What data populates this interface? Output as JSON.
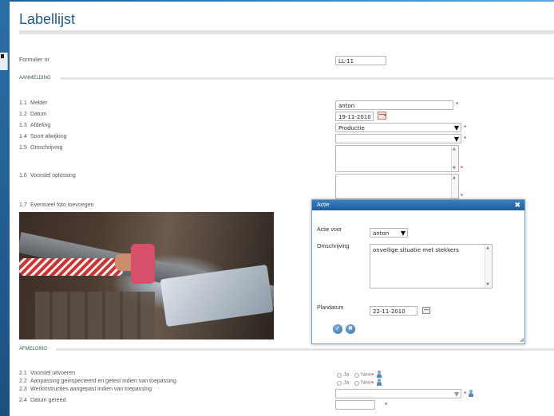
{
  "page_title": "Labellijst",
  "formulier": {
    "label": "Formulier nr.",
    "value": "LL-11"
  },
  "section_aanmelding": "AANMELDING",
  "fields": [
    {
      "num": "1.1",
      "label": "Melder",
      "value": "anton"
    },
    {
      "num": "1.2",
      "label": "Datum",
      "value": "19-11-2010"
    },
    {
      "num": "1.3",
      "label": "Afdeling",
      "value": "Productie"
    },
    {
      "num": "1.4",
      "label": "Soort afwijking",
      "value": ""
    },
    {
      "num": "1.5",
      "label": "Omschrijving",
      "value": ""
    },
    {
      "num": "1.6",
      "label": "Voorstel oplossing",
      "value": ""
    },
    {
      "num": "1.7",
      "label": "Eventueel foto toevoegen"
    }
  ],
  "required_mark": "*",
  "section_afmelding": "AFMELDING",
  "afmelding": [
    {
      "num": "2.1",
      "label": "Voorstel uitvoeren"
    },
    {
      "num": "2.2",
      "label": "Aanpassing geinspecteerd en getest indien van toepassing",
      "opt_yes": "Ja",
      "opt_no": "Nee"
    },
    {
      "num": "2.3",
      "label": "Werkinstructies aangepast indien van toepassing",
      "opt_yes": "Ja",
      "opt_no": "Nee"
    },
    {
      "num": "2.4",
      "label": "Datum gereed"
    }
  ],
  "dialog": {
    "title": "Actie",
    "actie_voor_label": "Actie voor",
    "actie_voor_value": "anton",
    "omschrijving_label": "Omschrijving",
    "omschrijving_value": "onveilige situatie met stekkers",
    "plandatum_label": "Plandatum",
    "plandatum_value": "22-11-2010"
  },
  "colors": {
    "accent": "#1d5d8f",
    "required": "#dd0000",
    "dialog_header": "#2a6aa8"
  }
}
